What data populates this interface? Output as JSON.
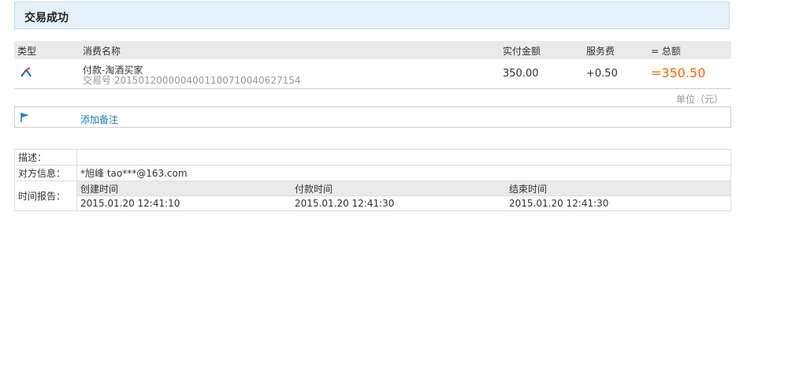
{
  "banner": {
    "title": "交易成功"
  },
  "tx": {
    "headers": {
      "type": "类型",
      "name": "消费名称",
      "paid": "实付金额",
      "fee": "服务费",
      "total": "= 总额"
    },
    "row": {
      "icon": "alipay-transfer-icon",
      "name": "付款-淘酒买家",
      "trade_no": "交易号 2015012000004001100710040627154",
      "paid": "350.00",
      "fee": "+0.50",
      "total": "=350.50"
    },
    "unit": "单位（元）"
  },
  "note": {
    "icon": "flag-icon",
    "link": "添加备注"
  },
  "detail": {
    "desc_label": "描述：",
    "desc_value": "",
    "party_label": "对方信息：",
    "party_value": "*旭峰 tao***@163.com",
    "time_label": "时间报告：",
    "time_headers": [
      "创建时间",
      "付款时间",
      "结束时间"
    ],
    "time_values": [
      "2015.01.20 12:41:10",
      "2015.01.20 12:41:30",
      "2015.01.20 12:41:30"
    ]
  },
  "colors": {
    "accent": "#ff6600",
    "link": "#1a7fc0",
    "banner_bg": "#e6f2fb"
  }
}
